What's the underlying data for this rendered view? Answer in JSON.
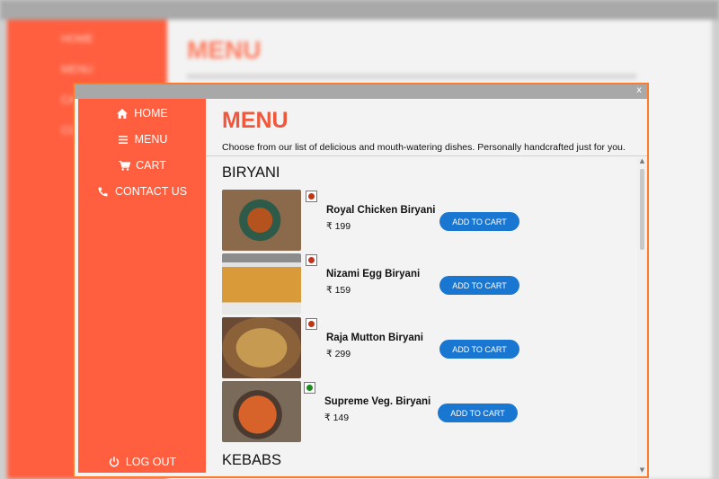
{
  "colors": {
    "accent": "#f0583c",
    "sidebar": "#ff5f3f",
    "button": "#1977d2",
    "nonveg": "#c0341c",
    "veg": "#1a8a1a"
  },
  "window": {
    "close_label": "x"
  },
  "sidebar": {
    "items": [
      {
        "label": "HOME",
        "icon": "home-icon"
      },
      {
        "label": "MENU",
        "icon": "list-icon"
      },
      {
        "label": "CART",
        "icon": "cart-icon"
      },
      {
        "label": "CONTACT US",
        "icon": "phone-icon"
      }
    ],
    "logout": {
      "label": "LOG OUT",
      "icon": "power-icon"
    }
  },
  "header": {
    "title": "MENU",
    "subtitle": "Choose from our list of delicious and mouth-watering dishes. Personally handcrafted just for you."
  },
  "sections": [
    {
      "title": "BIRYANI",
      "dishes": [
        {
          "name": "Royal Chicken Biryani",
          "price": "₹ 199",
          "type": "nonveg",
          "button": "ADD TO CART"
        },
        {
          "name": "Nizami Egg Biryani",
          "price": "₹ 159",
          "type": "nonveg",
          "button": "ADD TO CART"
        },
        {
          "name": "Raja Mutton Biryani",
          "price": "₹ 299",
          "type": "nonveg",
          "button": "ADD TO CART"
        },
        {
          "name": "Supreme Veg. Biryani",
          "price": "₹ 149",
          "type": "veg",
          "button": "ADD TO CART"
        }
      ]
    },
    {
      "title": "KEBABS",
      "dishes": []
    }
  ],
  "background_window": {
    "title": "MENU",
    "nav": [
      "HOME",
      "MENU",
      "CART",
      "CONTACT US"
    ]
  }
}
